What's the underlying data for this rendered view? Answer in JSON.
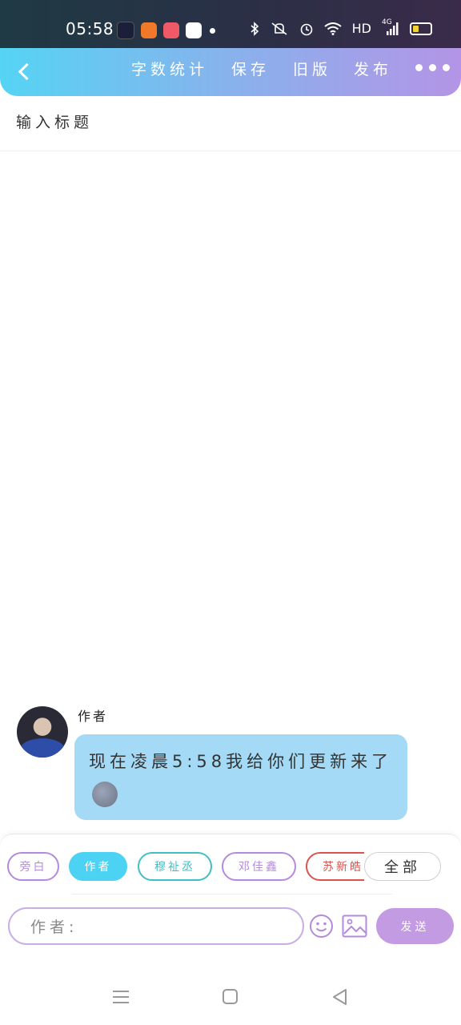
{
  "status_bar": {
    "time": "05:58",
    "network": "HD",
    "signal": "4G",
    "icons": [
      "app-icon-dark",
      "app-icon-orange",
      "app-icon-pink",
      "baidu-icon",
      "notification-dot",
      "bluetooth-icon",
      "vibrate-icon",
      "alarm-icon",
      "wifi-icon",
      "signal-icon",
      "battery-icon"
    ]
  },
  "toolbar": {
    "word_count": "字数统计",
    "save": "保存",
    "old_version": "旧版",
    "publish": "发布"
  },
  "editor": {
    "title_placeholder": "输入标题"
  },
  "message": {
    "speaker": "作者",
    "text": "现在凌晨5:58我给你们更新来了"
  },
  "roles": {
    "chips": [
      {
        "label": "旁白",
        "color": "#b48adf",
        "selected": false
      },
      {
        "label": "作者",
        "color": "#4cd2f2",
        "selected": true
      },
      {
        "label": "穆祉丞",
        "color": "#3fc0c3",
        "selected": false
      },
      {
        "label": "邓佳鑫",
        "color": "#b48adf",
        "selected": false
      },
      {
        "label": "苏新皓",
        "color": "#d9534f",
        "selected": false
      }
    ],
    "all": "全部"
  },
  "composer": {
    "input_text": "作者:",
    "send": "发送"
  },
  "colors": {
    "toolbar_start": "#55d4f4",
    "toolbar_end": "#b494e6",
    "bubble": "#a4daf6",
    "send_button": "#c29be3"
  }
}
